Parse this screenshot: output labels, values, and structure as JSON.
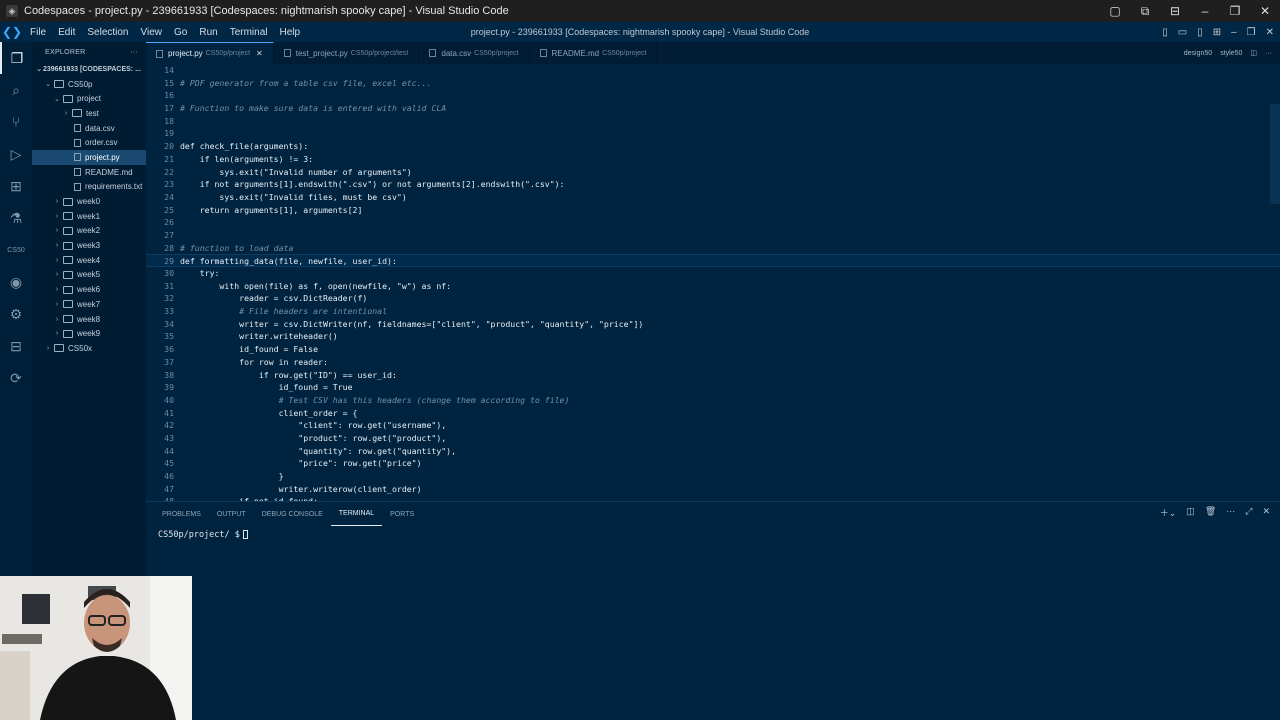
{
  "os_title": "Codespaces - project.py - 239661933 [Codespaces: nightmarish spooky cape] - Visual Studio Code",
  "window_title": "project.py - 239661933 [Codespaces: nightmarish spooky cape] - Visual Studio Code",
  "menu": [
    "File",
    "Edit",
    "Selection",
    "View",
    "Go",
    "Run",
    "Terminal",
    "Help"
  ],
  "sidebar": {
    "header": "EXPLORER",
    "root": "239661933 [CODESPACES: ...",
    "items": [
      {
        "label": "CS50p",
        "depth": 1,
        "type": "folder",
        "open": true
      },
      {
        "label": "project",
        "depth": 2,
        "type": "folder",
        "open": true
      },
      {
        "label": "test",
        "depth": 3,
        "type": "folder",
        "open": false
      },
      {
        "label": "data.csv",
        "depth": 3,
        "type": "file"
      },
      {
        "label": "order.csv",
        "depth": 3,
        "type": "file"
      },
      {
        "label": "project.py",
        "depth": 3,
        "type": "file",
        "selected": true
      },
      {
        "label": "README.md",
        "depth": 3,
        "type": "file"
      },
      {
        "label": "requirements.txt",
        "depth": 3,
        "type": "file"
      },
      {
        "label": "week0",
        "depth": 2,
        "type": "folder",
        "open": false
      },
      {
        "label": "week1",
        "depth": 2,
        "type": "folder",
        "open": false
      },
      {
        "label": "week2",
        "depth": 2,
        "type": "folder",
        "open": false
      },
      {
        "label": "week3",
        "depth": 2,
        "type": "folder",
        "open": false
      },
      {
        "label": "week4",
        "depth": 2,
        "type": "folder",
        "open": false
      },
      {
        "label": "week5",
        "depth": 2,
        "type": "folder",
        "open": false
      },
      {
        "label": "week6",
        "depth": 2,
        "type": "folder",
        "open": false
      },
      {
        "label": "week7",
        "depth": 2,
        "type": "folder",
        "open": false
      },
      {
        "label": "week8",
        "depth": 2,
        "type": "folder",
        "open": false
      },
      {
        "label": "week9",
        "depth": 2,
        "type": "folder",
        "open": false
      },
      {
        "label": "CS50x",
        "depth": 1,
        "type": "folder",
        "open": false
      }
    ]
  },
  "tabs": [
    {
      "label": "project.py",
      "path": "CS50p/project",
      "active": true
    },
    {
      "label": "test_project.py",
      "path": "CS50p/project/test",
      "active": false
    },
    {
      "label": "data.csv",
      "path": "CS50p/project",
      "active": false
    },
    {
      "label": "README.md",
      "path": "CS50p/project",
      "active": false
    }
  ],
  "tab_right": [
    "design50",
    "style50"
  ],
  "editor": {
    "current_line": "29",
    "lines": [
      {
        "n": "14",
        "t": ""
      },
      {
        "n": "15",
        "t": "# PDF generator from a table csv file, excel etc...",
        "c": true
      },
      {
        "n": "16",
        "t": ""
      },
      {
        "n": "17",
        "t": "# Function to make sure data is entered with valid CLA",
        "c": true
      },
      {
        "n": "18",
        "t": ""
      },
      {
        "n": "19",
        "t": ""
      },
      {
        "n": "20",
        "t": "def check_file(arguments):"
      },
      {
        "n": "21",
        "t": "    if len(arguments) != 3:"
      },
      {
        "n": "22",
        "t": "        sys.exit(\"Invalid number of arguments\")"
      },
      {
        "n": "23",
        "t": "    if not arguments[1].endswith(\".csv\") or not arguments[2].endswith(\".csv\"):"
      },
      {
        "n": "24",
        "t": "        sys.exit(\"Invalid files, must be csv\")"
      },
      {
        "n": "25",
        "t": "    return arguments[1], arguments[2]"
      },
      {
        "n": "26",
        "t": ""
      },
      {
        "n": "27",
        "t": ""
      },
      {
        "n": "28",
        "t": "# function to load data",
        "c": true
      },
      {
        "n": "29",
        "t": "def formatting_data(file, newfile, user_id):"
      },
      {
        "n": "30",
        "t": "    try:"
      },
      {
        "n": "31",
        "t": "        with open(file) as f, open(newfile, \"w\") as nf:"
      },
      {
        "n": "32",
        "t": "            reader = csv.DictReader(f)"
      },
      {
        "n": "33",
        "t": "            # File headers are intentional",
        "c": true
      },
      {
        "n": "34",
        "t": "            writer = csv.DictWriter(nf, fieldnames=[\"client\", \"product\", \"quantity\", \"price\"])"
      },
      {
        "n": "35",
        "t": "            writer.writeheader()"
      },
      {
        "n": "36",
        "t": "            id_found = False"
      },
      {
        "n": "37",
        "t": "            for row in reader:"
      },
      {
        "n": "38",
        "t": "                if row.get(\"ID\") == user_id:"
      },
      {
        "n": "39",
        "t": "                    id_found = True"
      },
      {
        "n": "40",
        "t": "                    # Test CSV has this headers (change them according to file)",
        "c": true
      },
      {
        "n": "41",
        "t": "                    client_order = {"
      },
      {
        "n": "42",
        "t": "                        \"client\": row.get(\"username\"),"
      },
      {
        "n": "43",
        "t": "                        \"product\": row.get(\"product\"),"
      },
      {
        "n": "44",
        "t": "                        \"quantity\": row.get(\"quantity\"),"
      },
      {
        "n": "45",
        "t": "                        \"price\": row.get(\"price\")"
      },
      {
        "n": "46",
        "t": "                    }"
      },
      {
        "n": "47",
        "t": "                    writer.writerow(client_order)"
      },
      {
        "n": "48",
        "t": "            if not id_found:"
      }
    ]
  },
  "panel": {
    "tabs": [
      "PROBLEMS",
      "OUTPUT",
      "DEBUG CONSOLE",
      "TERMINAL",
      "PORTS"
    ],
    "active_tab": "TERMINAL",
    "prompt": "CS50p/project/ $"
  }
}
